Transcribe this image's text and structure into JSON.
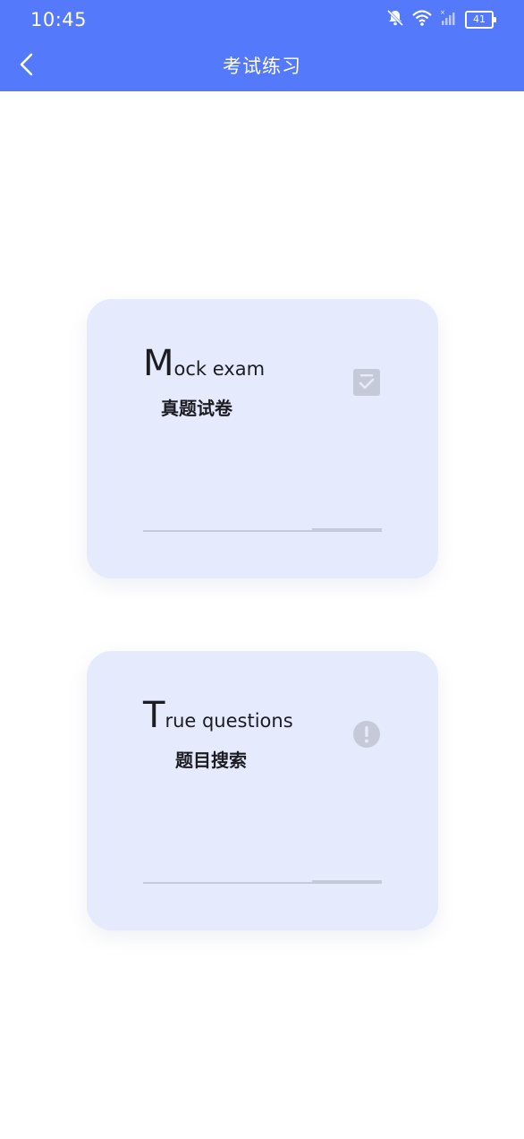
{
  "status": {
    "time": "10:45",
    "battery": "41",
    "icons": [
      "bell-off-icon",
      "wifi-icon",
      "signal-icon",
      "battery-icon"
    ]
  },
  "header": {
    "title": "考试练习",
    "back_icon": "back-arrow-icon"
  },
  "cards": [
    {
      "eng_first": "M",
      "eng_rest": "ock exam",
      "zh": "真题试卷",
      "icon": "exam-paper-check-icon"
    },
    {
      "eng_first": "T",
      "eng_rest": "rue questions",
      "zh": "题目搜索",
      "icon": "exclamation-circle-icon"
    }
  ],
  "colors": {
    "header_bg": "#5479fb",
    "card_bg": "#e5eafc",
    "icon_gray": "#c6cad8"
  }
}
